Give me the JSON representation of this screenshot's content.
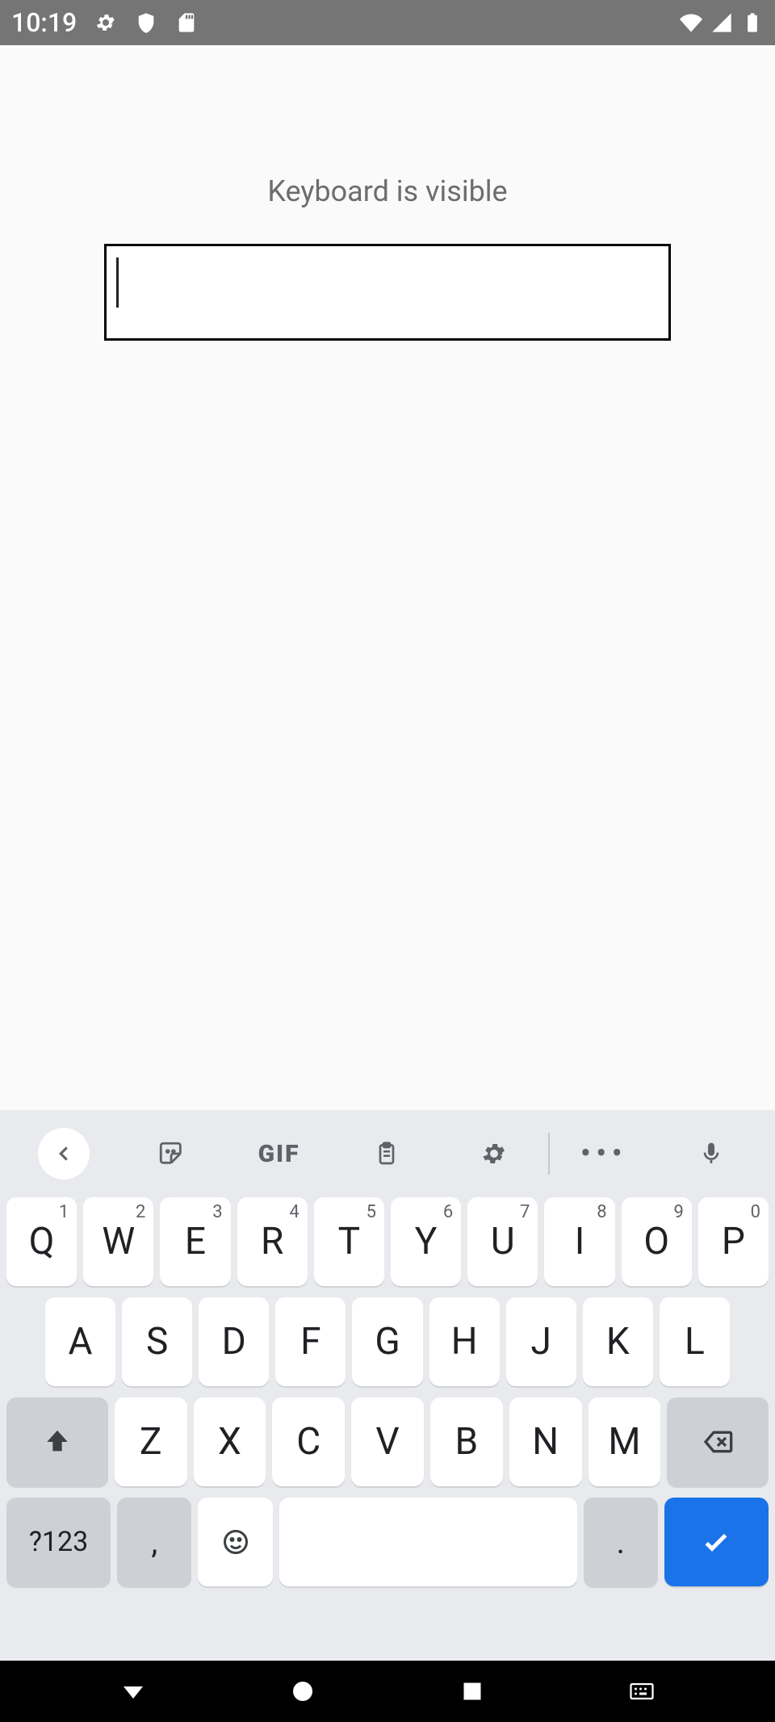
{
  "status_bar": {
    "clock": "10:19"
  },
  "app": {
    "label": "Keyboard is visible",
    "input_value": ""
  },
  "keyboard": {
    "toolbar": {
      "gif_label": "GIF"
    },
    "row1": [
      {
        "main": "Q",
        "hint": "1"
      },
      {
        "main": "W",
        "hint": "2"
      },
      {
        "main": "E",
        "hint": "3"
      },
      {
        "main": "R",
        "hint": "4"
      },
      {
        "main": "T",
        "hint": "5"
      },
      {
        "main": "Y",
        "hint": "6"
      },
      {
        "main": "U",
        "hint": "7"
      },
      {
        "main": "I",
        "hint": "8"
      },
      {
        "main": "O",
        "hint": "9"
      },
      {
        "main": "P",
        "hint": "0"
      }
    ],
    "row2": [
      {
        "main": "A"
      },
      {
        "main": "S"
      },
      {
        "main": "D"
      },
      {
        "main": "F"
      },
      {
        "main": "G"
      },
      {
        "main": "H"
      },
      {
        "main": "J"
      },
      {
        "main": "K"
      },
      {
        "main": "L"
      }
    ],
    "row3": [
      {
        "main": "Z"
      },
      {
        "main": "X"
      },
      {
        "main": "C"
      },
      {
        "main": "V"
      },
      {
        "main": "B"
      },
      {
        "main": "N"
      },
      {
        "main": "M"
      }
    ],
    "row4": {
      "symbols": "?123",
      "comma": ",",
      "period": "."
    }
  }
}
